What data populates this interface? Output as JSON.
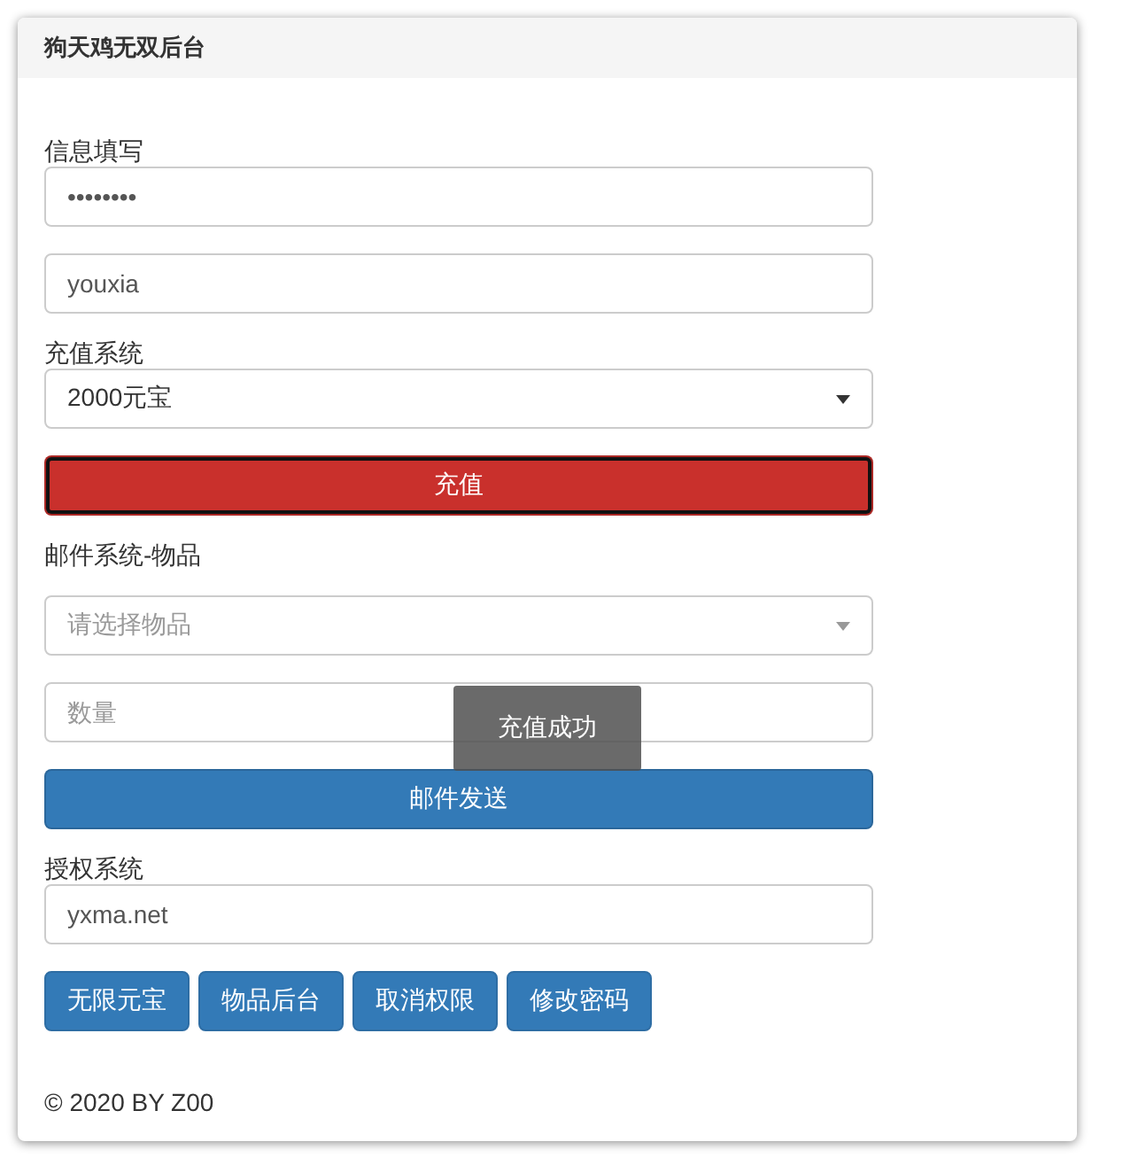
{
  "title": "狗天鸡无双后台",
  "items": [
    {
      "kind": "label",
      "text": "信息填写"
    },
    {
      "kind": "input",
      "value": "••••••••"
    },
    {
      "kind": "input",
      "value": "youxia"
    },
    {
      "kind": "label",
      "text": "充值系统"
    },
    {
      "kind": "select",
      "value": "2000元宝"
    },
    {
      "kind": "button",
      "text": "充值",
      "color": "#c9302c",
      "focused": true
    },
    {
      "kind": "heading",
      "text": "邮件系统-物品"
    },
    {
      "kind": "select",
      "placeholder": "请选择物品"
    },
    {
      "kind": "input",
      "placeholder": "数量"
    },
    {
      "kind": "button",
      "text": "邮件发送",
      "color": "#337ab7",
      "focused": false
    },
    {
      "kind": "label",
      "text": "授权系统"
    },
    {
      "kind": "input",
      "value": "yxma.net"
    }
  ],
  "actions": [
    "无限元宝",
    "物品后台",
    "取消权限",
    "修改密码"
  ],
  "toast": "充值成功",
  "footer": "© 2020 BY Z00"
}
